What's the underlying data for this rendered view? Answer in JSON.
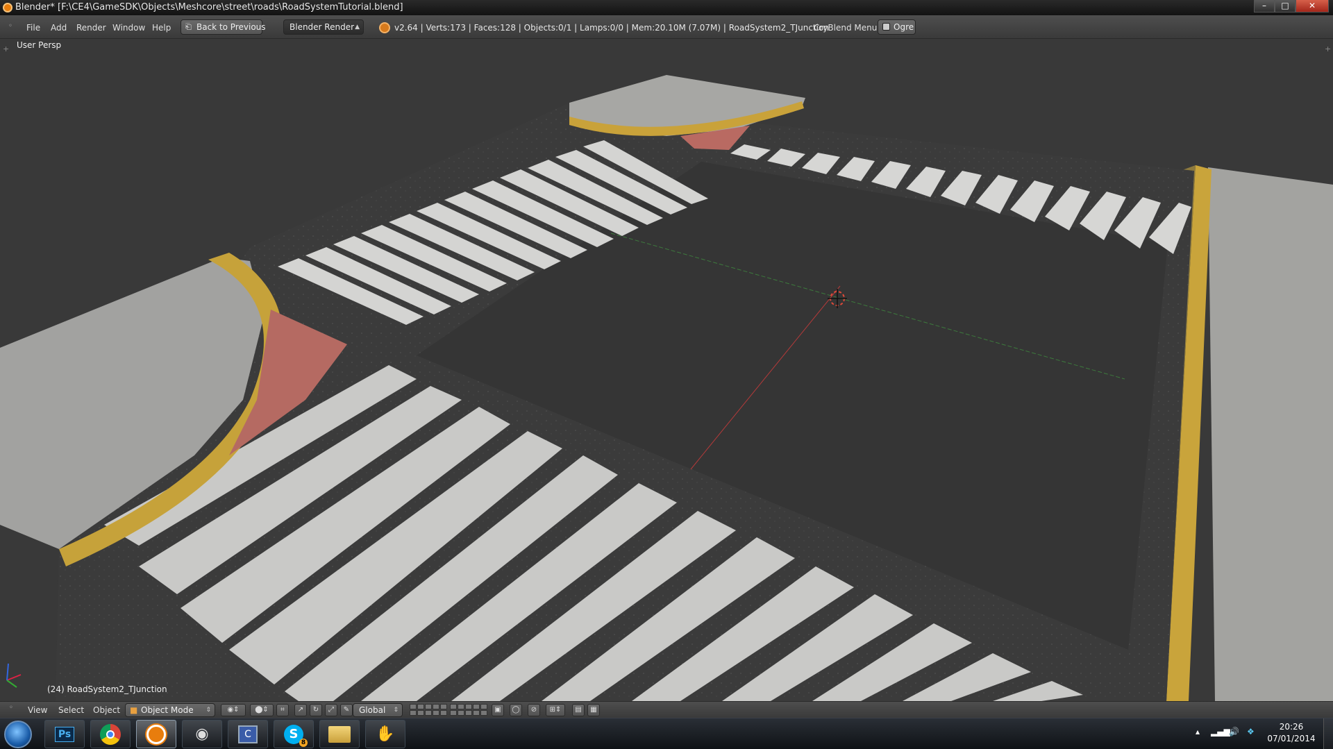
{
  "window": {
    "title": "Blender* [F:\\CE4\\GameSDK\\Objects\\Meshcore\\street\\roads\\RoadSystemTutorial.blend]",
    "minimize": "–",
    "maximize": "□",
    "close": "✕"
  },
  "header": {
    "menus": [
      "File",
      "Add",
      "Render",
      "Window",
      "Help"
    ],
    "back_button": "Back to Previous",
    "render_engine": "Blender Render",
    "stats": "v2.64 | Verts:173 | Faces:128 | Objects:0/1 | Lamps:0/0 | Mem:20.10M (7.07M) | RoadSystem2_TJunction",
    "crymenu": "CryBlend Menu",
    "ogre_button": "Ogre"
  },
  "viewport": {
    "view_label": "User Persp",
    "object_label": "(24) RoadSystem2_TJunction"
  },
  "view3d_header": {
    "menus": [
      "View",
      "Select",
      "Object"
    ],
    "mode": "Object Mode",
    "orientation": "Global"
  },
  "taskbar": {
    "apps": [
      "start-orb",
      "photoshop",
      "chrome",
      "blender",
      "eye-app",
      "crytek-app",
      "skype",
      "file-explorer",
      "hand-app"
    ],
    "active_app": "blender",
    "skype_badge": "8",
    "time": "20:26",
    "date": "07/01/2014"
  },
  "colors": {
    "viewport_bg": "#393939",
    "asphalt": "#3a3a3a",
    "stripe": "#d9d9d9",
    "curb": "#c6a33b",
    "pavement": "#a8a8a6",
    "brick": "#b0655f"
  }
}
